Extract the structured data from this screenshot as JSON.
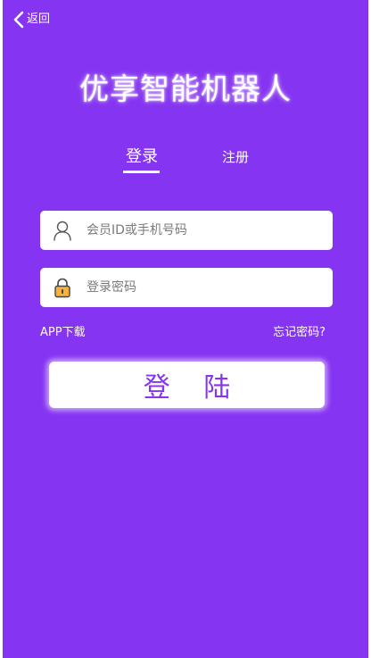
{
  "header": {
    "back_label": "返回",
    "back_icon": "chevron-left-icon"
  },
  "app": {
    "title": "优享智能机器人"
  },
  "tabs": [
    {
      "label": "登录",
      "active": true
    },
    {
      "label": "注册",
      "active": false
    }
  ],
  "form": {
    "username": {
      "value": "",
      "placeholder": "会员ID或手机号码",
      "icon": "user-icon"
    },
    "password": {
      "value": "",
      "placeholder": "登录密码",
      "icon": "lock-icon"
    }
  },
  "links": {
    "app_download": "APP下载",
    "forgot_password": "忘记密码?"
  },
  "login_button": {
    "label": "登 陆"
  },
  "colors": {
    "background": "#8534f1",
    "button_text": "#8534f1",
    "text": "#ffffff",
    "field": "#ffffff",
    "lock_accent": "#f5b33d"
  }
}
